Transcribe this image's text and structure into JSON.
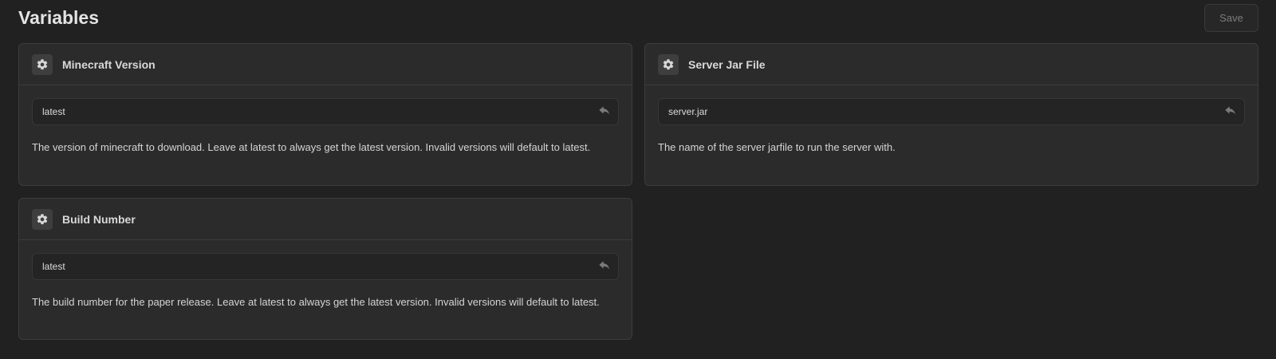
{
  "header": {
    "title": "Variables",
    "save_label": "Save"
  },
  "variables": [
    {
      "title": "Minecraft Version",
      "value": "latest",
      "description": "The version of minecraft to download. Leave at latest to always get the latest version. Invalid versions will default to latest."
    },
    {
      "title": "Server Jar File",
      "value": "server.jar",
      "description": "The name of the server jarfile to run the server with."
    },
    {
      "title": "Build Number",
      "value": "latest",
      "description": "The build number for the paper release. Leave at latest to always get the latest version. Invalid versions will default to latest."
    }
  ],
  "icons": {
    "card_icon": "gear-icon",
    "reset_icon": "undo-icon"
  },
  "colors": {
    "background": "#212121",
    "card": "#2b2b2b",
    "border": "#3c3c3c"
  }
}
